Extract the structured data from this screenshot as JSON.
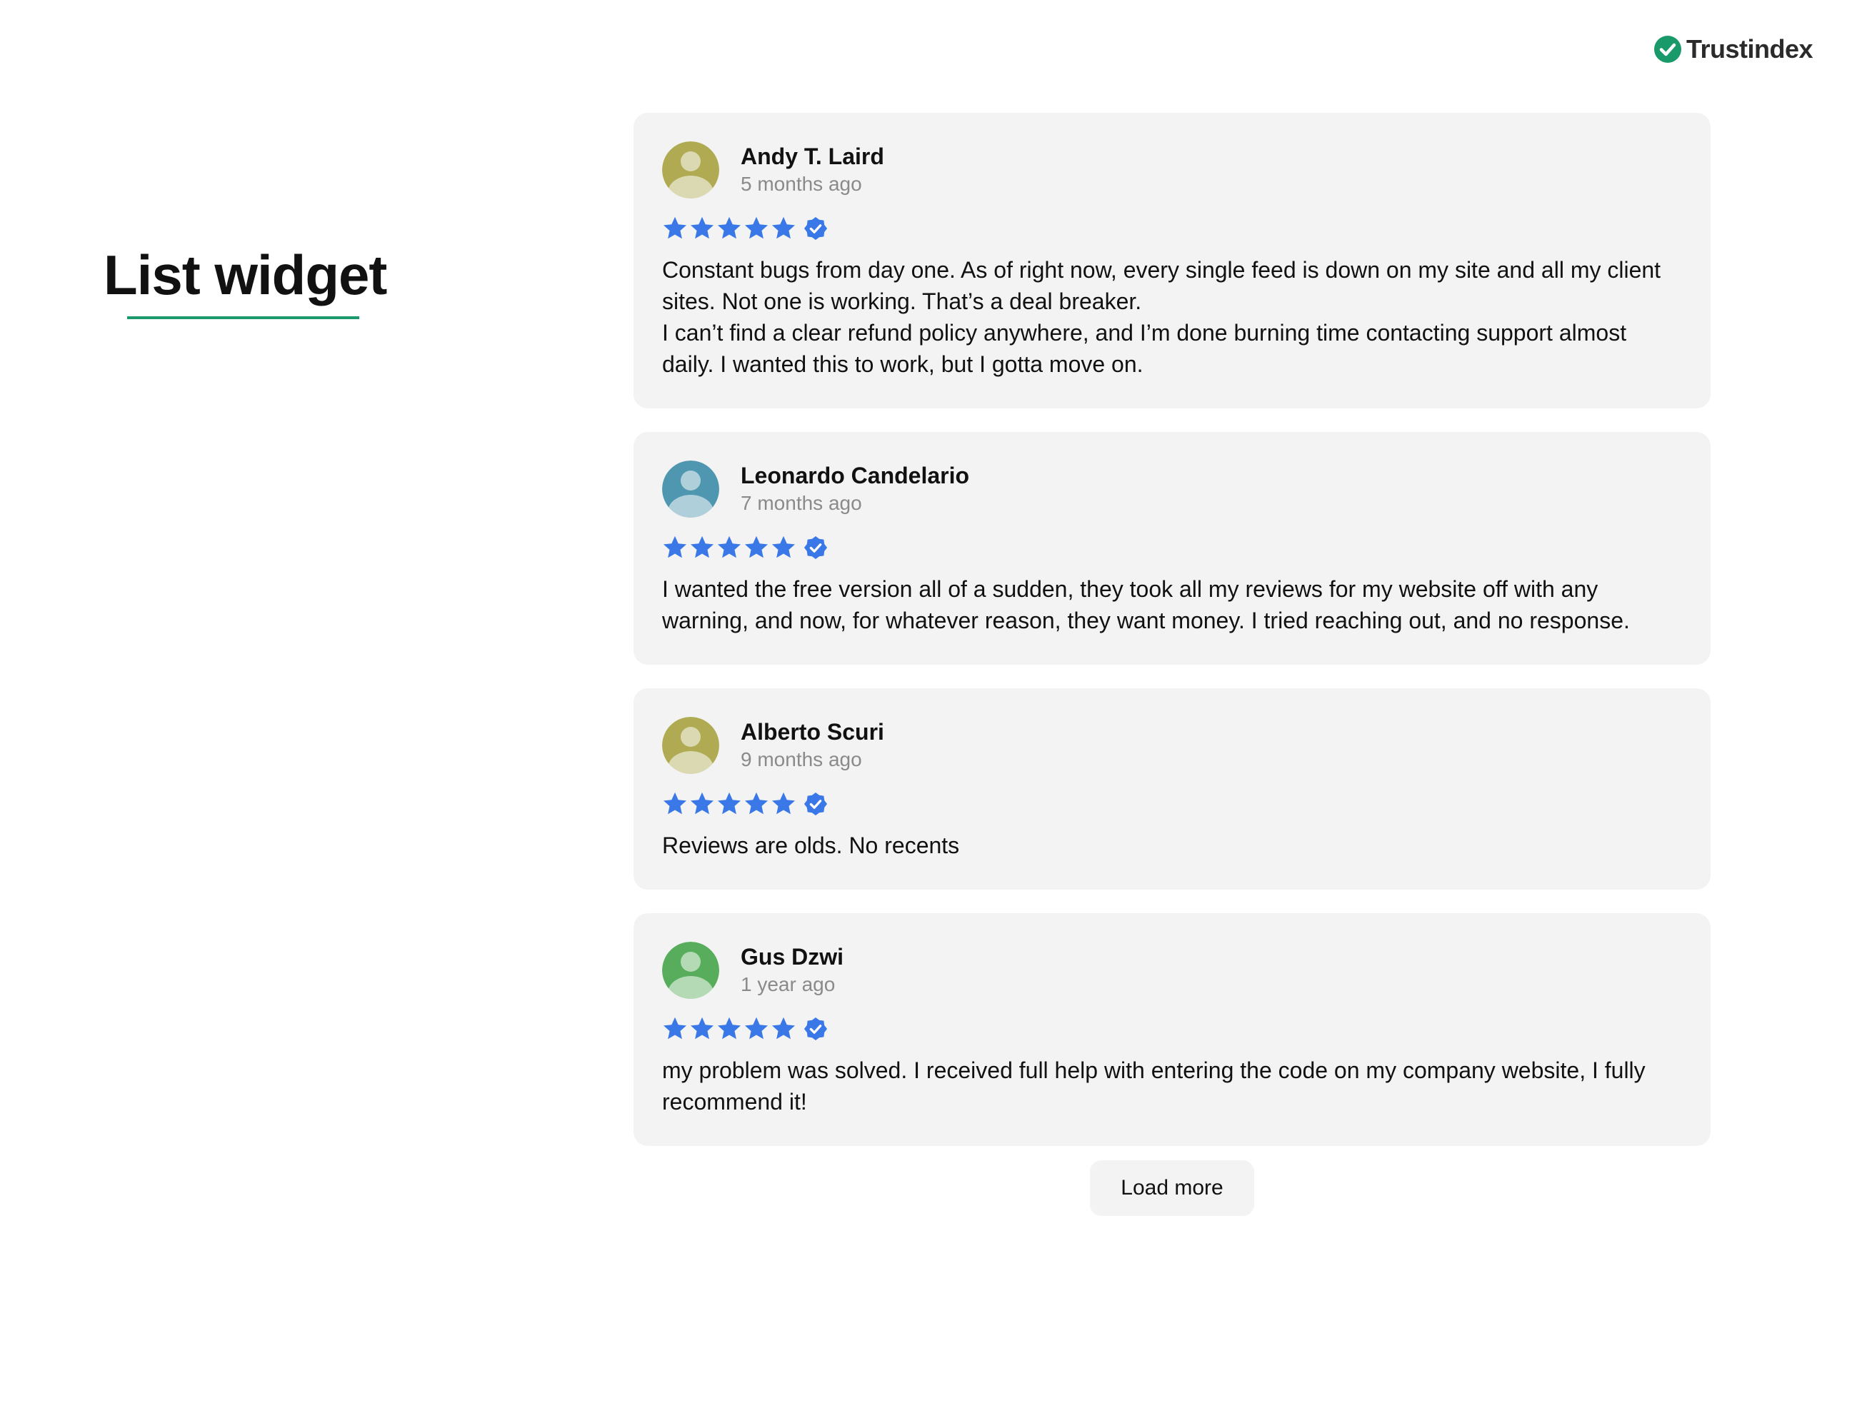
{
  "brand": {
    "name": "Trustindex",
    "icon": "check-circle-icon",
    "color": "#1a9a6a"
  },
  "page": {
    "title": "List widget",
    "accent": "#1a9a6a"
  },
  "colors": {
    "star": "#3a78e8",
    "card_bg": "#f3f3f3",
    "muted_text": "#8a8a8a"
  },
  "reviews": [
    {
      "name": "Andy T. Laird",
      "date": "5 months ago",
      "rating": 5,
      "verified": true,
      "avatar_color": "#b0ab52",
      "text": "Constant bugs from day one. As of right now, every single feed is down on my site and all my client sites. Not one is working. That’s a deal breaker.\nI can’t find a clear refund policy anywhere, and I’m done burning time contacting support almost daily. I wanted this to work, but I gotta move on."
    },
    {
      "name": "Leonardo Candelario",
      "date": "7 months ago",
      "rating": 5,
      "verified": true,
      "avatar_color": "#4f97b0",
      "text": "I wanted the free version all of a sudden, they took all my reviews for my website off with any warning, and now, for whatever reason, they want money. I tried reaching out, and no response."
    },
    {
      "name": "Alberto Scuri",
      "date": "9 months ago",
      "rating": 5,
      "verified": true,
      "avatar_color": "#b0ab52",
      "text": "Reviews are olds. No recents"
    },
    {
      "name": "Gus Dzwi",
      "date": "1 year ago",
      "rating": 5,
      "verified": true,
      "avatar_color": "#58ad5c",
      "text": "my problem was solved. I received full help with entering the code on my company website, I fully recommend it!"
    }
  ],
  "load_more_label": "Load more"
}
